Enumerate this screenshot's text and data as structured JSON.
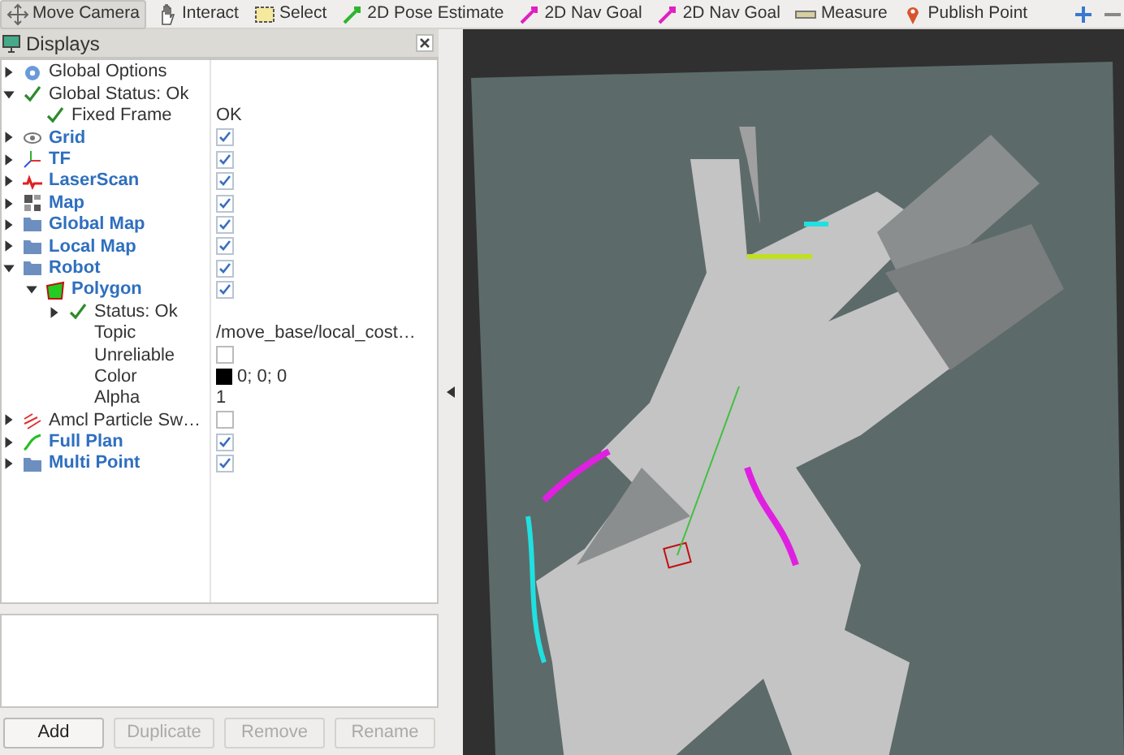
{
  "toolbar": [
    {
      "label": "Move Camera",
      "kind": "move",
      "selected": true
    },
    {
      "label": "Interact",
      "kind": "hand",
      "selected": false
    },
    {
      "label": "Select",
      "kind": "select",
      "selected": false
    },
    {
      "label": "2D Pose Estimate",
      "kind": "pose",
      "selected": false
    },
    {
      "label": "2D Nav Goal",
      "kind": "goal",
      "selected": false
    },
    {
      "label": "2D Nav Goal",
      "kind": "goal",
      "selected": false
    },
    {
      "label": "Measure",
      "kind": "measure",
      "selected": false
    },
    {
      "label": "Publish Point",
      "kind": "point",
      "selected": false
    }
  ],
  "displays": {
    "title": "Displays",
    "tree": [
      {
        "label": "Global Options",
        "kind": "options",
        "expanded": false
      },
      {
        "label": "Global Status: Ok",
        "kind": "status",
        "expanded": true,
        "children": [
          {
            "label": "Fixed Frame",
            "kind": "status",
            "value": {
              "kind": "text",
              "text": "OK"
            }
          }
        ]
      },
      {
        "label": "Grid",
        "kind": "grid",
        "expanded": false,
        "value": {
          "kind": "check",
          "checked": true
        }
      },
      {
        "label": "TF",
        "kind": "tf",
        "expanded": false,
        "value": {
          "kind": "check",
          "checked": true
        }
      },
      {
        "label": "LaserScan",
        "kind": "laser",
        "expanded": false,
        "value": {
          "kind": "check",
          "checked": true
        }
      },
      {
        "label": "Map",
        "kind": "map",
        "expanded": false,
        "value": {
          "kind": "check",
          "checked": true
        }
      },
      {
        "label": "Global Map",
        "kind": "group",
        "expanded": false,
        "value": {
          "kind": "check",
          "checked": true
        }
      },
      {
        "label": "Local Map",
        "kind": "group",
        "expanded": false,
        "value": {
          "kind": "check",
          "checked": true
        }
      },
      {
        "label": "Robot",
        "kind": "group",
        "expanded": true,
        "value": {
          "kind": "check",
          "checked": true
        },
        "children": [
          {
            "label": "Polygon",
            "kind": "polygon",
            "expanded": true,
            "value": {
              "kind": "check",
              "checked": true
            },
            "children": [
              {
                "label": "Status: Ok",
                "kind": "status",
                "expanded": false
              },
              {
                "label": "Topic",
                "kind": "property",
                "value": {
                  "kind": "text",
                  "text": "/move_base/local_cost…"
                }
              },
              {
                "label": "Unreliable",
                "kind": "property",
                "value": {
                  "kind": "check",
                  "checked": false
                }
              },
              {
                "label": "Color",
                "kind": "property",
                "value": {
                  "kind": "color",
                  "color": "#000000",
                  "text": "0; 0; 0"
                }
              },
              {
                "label": "Alpha",
                "kind": "property",
                "value": {
                  "kind": "text",
                  "text": "1"
                }
              }
            ]
          }
        ]
      },
      {
        "label": "Amcl Particle Sw…",
        "kind": "particles",
        "expanded": false,
        "value": {
          "kind": "check",
          "checked": false
        }
      },
      {
        "label": "Full Plan",
        "kind": "path",
        "expanded": false,
        "value": {
          "kind": "check",
          "checked": true
        }
      },
      {
        "label": "Multi Point",
        "kind": "group",
        "expanded": false,
        "value": {
          "kind": "check",
          "checked": true
        }
      }
    ],
    "buttons": [
      {
        "label": "Add",
        "disabled": false
      },
      {
        "label": "Duplicate",
        "disabled": true
      },
      {
        "label": "Remove",
        "disabled": true
      },
      {
        "label": "Rename",
        "disabled": true
      }
    ]
  }
}
